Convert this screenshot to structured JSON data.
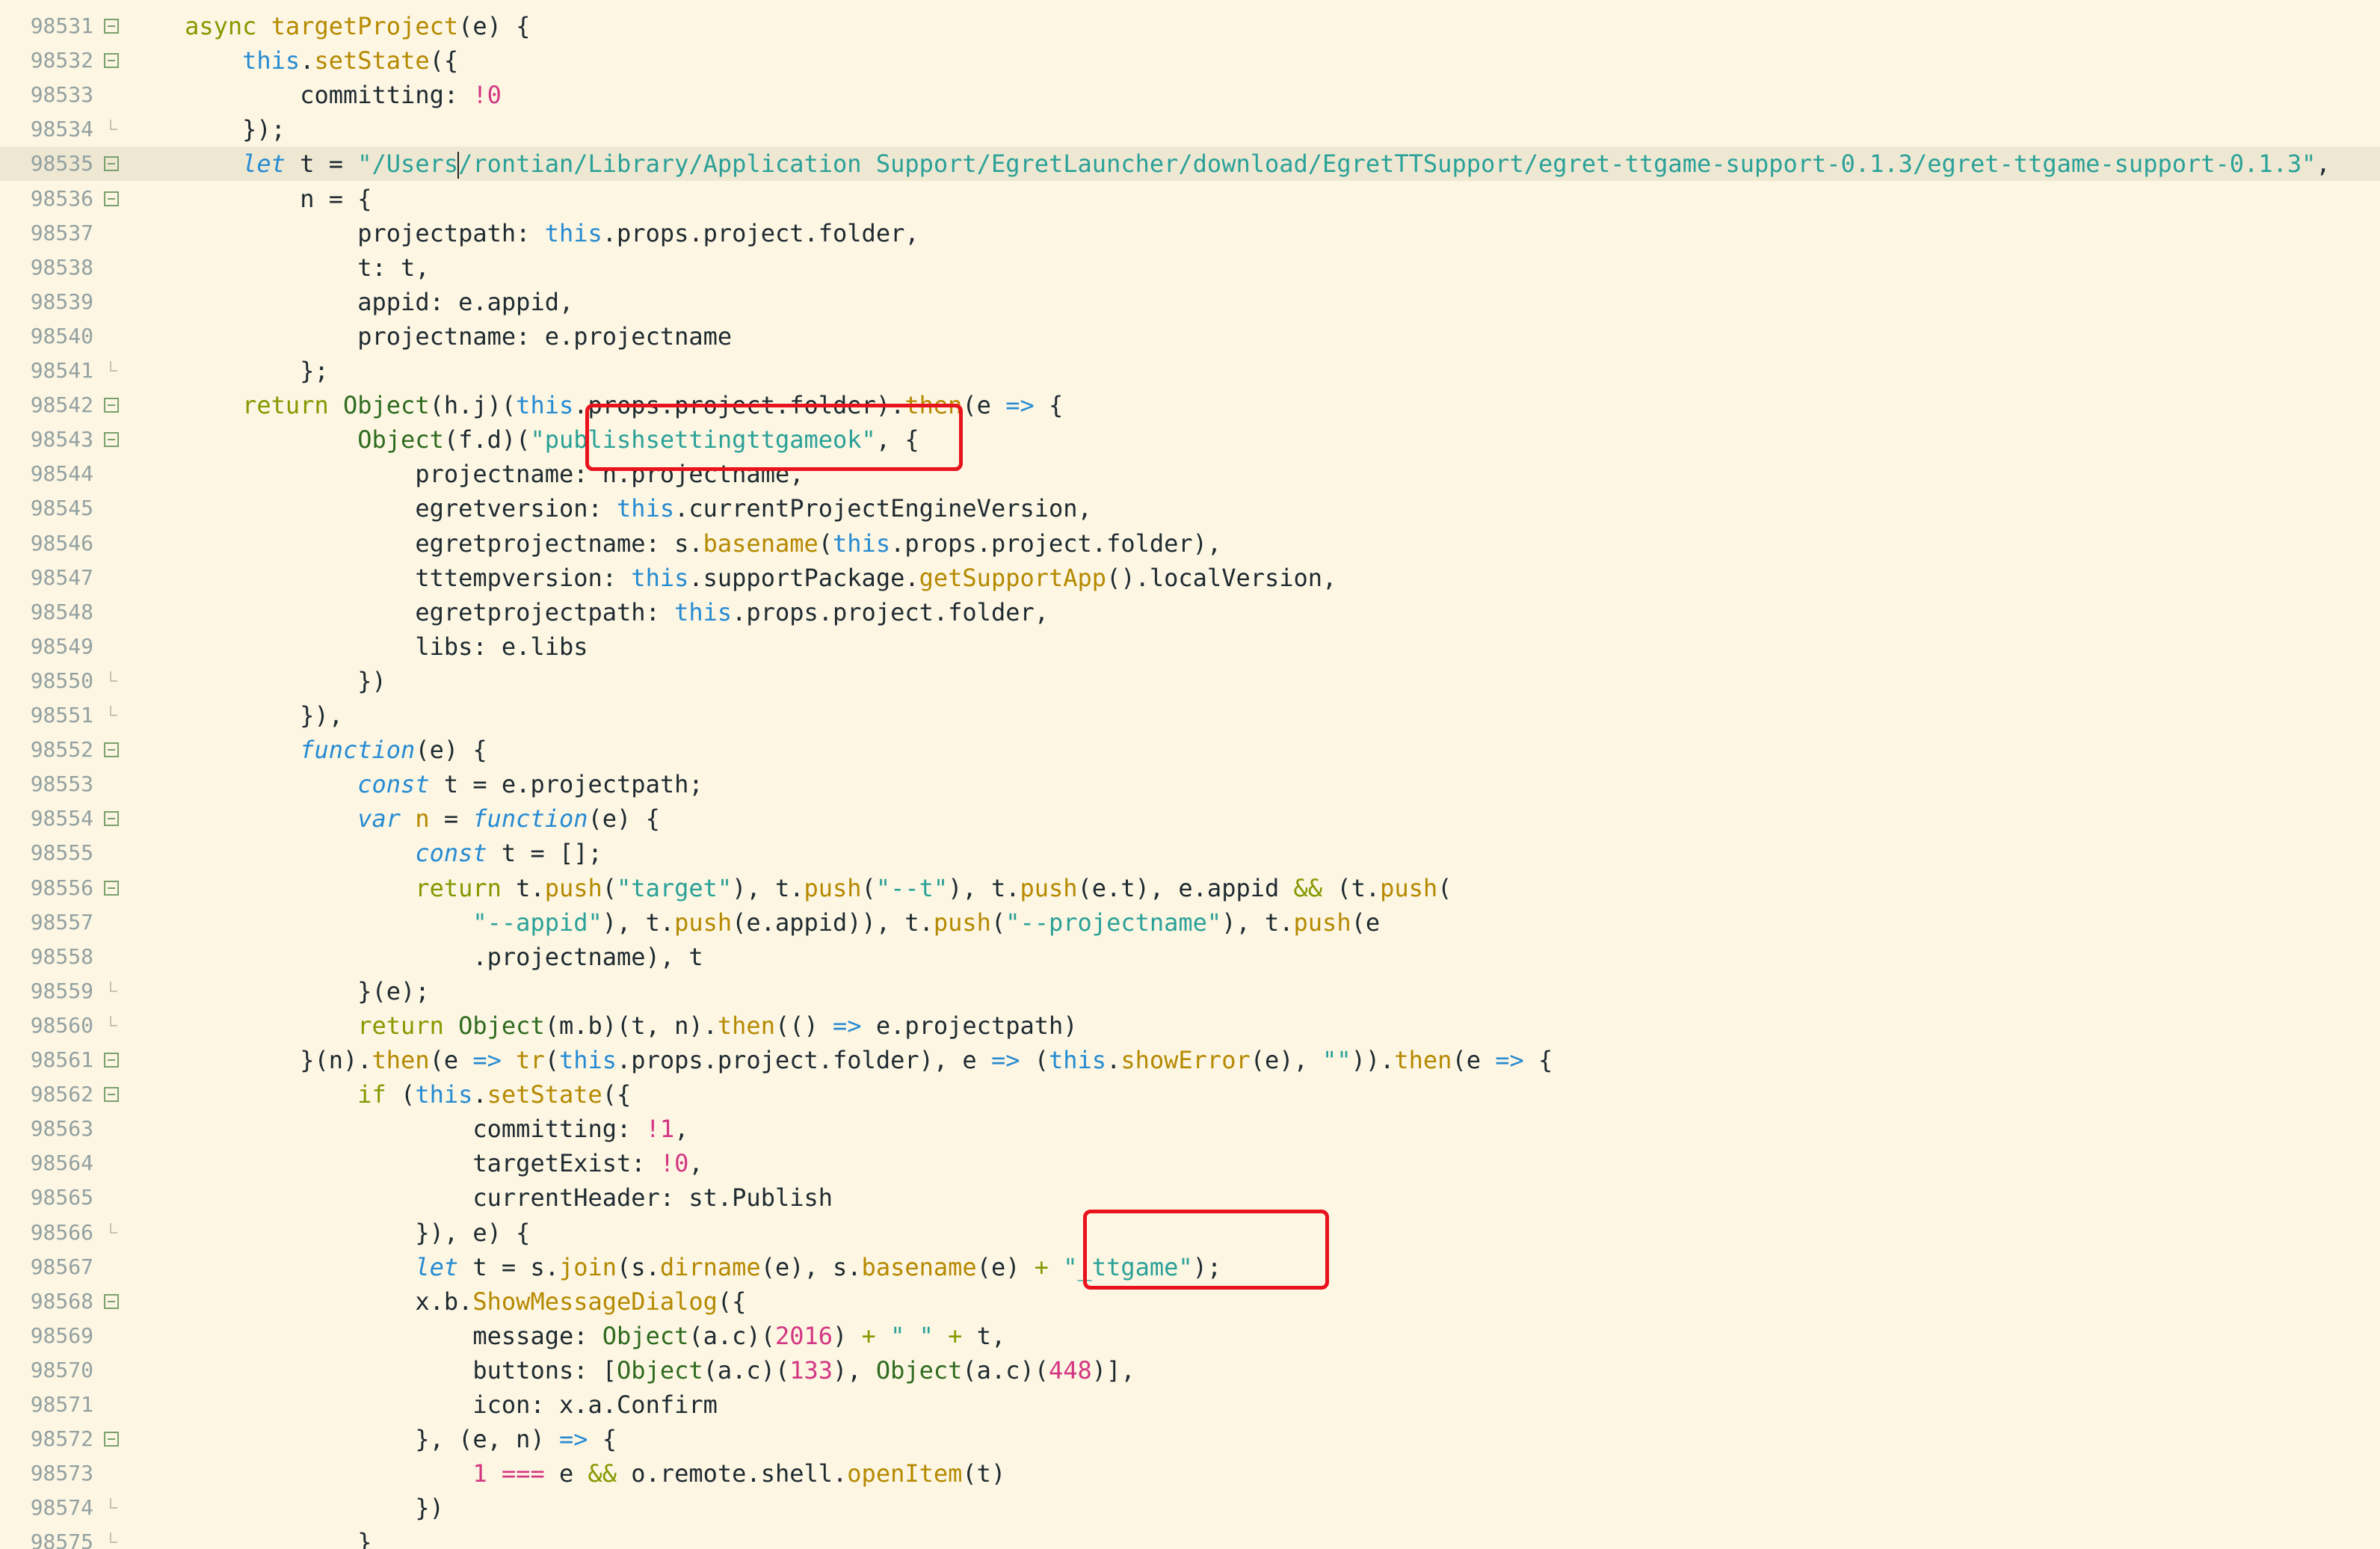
{
  "editor": {
    "current_line_index": 4,
    "cursor_line_index": 4,
    "lines": [
      {
        "no": "98531",
        "fold": "open",
        "indent": "    ",
        "tokens": [
          [
            "kw",
            "async "
          ],
          [
            "fn",
            "targetProject"
          ],
          [
            "id",
            "(e) {"
          ]
        ]
      },
      {
        "no": "98532",
        "fold": "open",
        "indent": "        ",
        "tokens": [
          [
            "this",
            "this"
          ],
          [
            "id",
            "."
          ],
          [
            "fn",
            "setState"
          ],
          [
            "id",
            "({"
          ]
        ]
      },
      {
        "no": "98533",
        "fold": "none",
        "indent": "            ",
        "tokens": [
          [
            "id",
            "committing: "
          ],
          [
            "ex",
            "!"
          ],
          [
            "num",
            "0"
          ]
        ]
      },
      {
        "no": "98534",
        "fold": "end",
        "indent": "        ",
        "tokens": [
          [
            "id",
            "});"
          ]
        ]
      },
      {
        "no": "98535",
        "fold": "open",
        "indent": "        ",
        "tokens": [
          [
            "ital",
            "let"
          ],
          [
            "id",
            " t = "
          ],
          [
            "str",
            "\"/Users"
          ],
          [
            "cursor",
            ""
          ],
          [
            "str",
            "/rontian/Library/Application Support/EgretLauncher/download/EgretTTSupport/egret-ttgame-support-0.1.3/egret-ttgame-support-0.1.3\""
          ],
          [
            "id",
            ","
          ]
        ]
      },
      {
        "no": "98536",
        "fold": "open",
        "indent": "            ",
        "tokens": [
          [
            "id",
            "n = {"
          ]
        ]
      },
      {
        "no": "98537",
        "fold": "none",
        "indent": "                ",
        "tokens": [
          [
            "id",
            "projectpath: "
          ],
          [
            "this",
            "this"
          ],
          [
            "id",
            ".props.project.folder,"
          ]
        ]
      },
      {
        "no": "98538",
        "fold": "none",
        "indent": "                ",
        "tokens": [
          [
            "id",
            "t: t,"
          ]
        ]
      },
      {
        "no": "98539",
        "fold": "none",
        "indent": "                ",
        "tokens": [
          [
            "id",
            "appid: e.appid,"
          ]
        ]
      },
      {
        "no": "98540",
        "fold": "none",
        "indent": "                ",
        "tokens": [
          [
            "id",
            "projectname: e.projectname"
          ]
        ]
      },
      {
        "no": "98541",
        "fold": "end",
        "indent": "            ",
        "tokens": [
          [
            "id",
            "};"
          ]
        ]
      },
      {
        "no": "98542",
        "fold": "open",
        "indent": "        ",
        "tokens": [
          [
            "kw",
            "return "
          ],
          [
            "cls",
            "Object"
          ],
          [
            "id",
            "(h.j)("
          ],
          [
            "this",
            "this"
          ],
          [
            "id",
            ".props.project.folder)."
          ],
          [
            "fn",
            "then"
          ],
          [
            "id",
            "(e "
          ],
          [
            "arrow",
            "=>"
          ],
          [
            "id",
            " {"
          ]
        ]
      },
      {
        "no": "98543",
        "fold": "open",
        "indent": "                ",
        "tokens": [
          [
            "cls",
            "Object"
          ],
          [
            "id",
            "(f.d)("
          ],
          [
            "str",
            "\"publishsettingttgameok\""
          ],
          [
            "id",
            ", {"
          ]
        ]
      },
      {
        "no": "98544",
        "fold": "none",
        "indent": "                    ",
        "tokens": [
          [
            "id",
            "projectname: n.projectname,"
          ]
        ]
      },
      {
        "no": "98545",
        "fold": "none",
        "indent": "                    ",
        "tokens": [
          [
            "id",
            "egretversion: "
          ],
          [
            "this",
            "this"
          ],
          [
            "id",
            ".currentProjectEngineVersion,"
          ]
        ]
      },
      {
        "no": "98546",
        "fold": "none",
        "indent": "                    ",
        "tokens": [
          [
            "id",
            "egretprojectname: s."
          ],
          [
            "fn",
            "basename"
          ],
          [
            "id",
            "("
          ],
          [
            "this",
            "this"
          ],
          [
            "id",
            ".props.project.folder),"
          ]
        ]
      },
      {
        "no": "98547",
        "fold": "none",
        "indent": "                    ",
        "tokens": [
          [
            "id",
            "tttempversion: "
          ],
          [
            "this",
            "this"
          ],
          [
            "id",
            ".supportPackage."
          ],
          [
            "fn",
            "getSupportApp"
          ],
          [
            "id",
            "().localVersion,"
          ]
        ]
      },
      {
        "no": "98548",
        "fold": "none",
        "indent": "                    ",
        "tokens": [
          [
            "id",
            "egretprojectpath: "
          ],
          [
            "this",
            "this"
          ],
          [
            "id",
            ".props.project.folder,"
          ]
        ]
      },
      {
        "no": "98549",
        "fold": "none",
        "indent": "                    ",
        "tokens": [
          [
            "id",
            "libs: e.libs"
          ]
        ]
      },
      {
        "no": "98550",
        "fold": "end",
        "indent": "                ",
        "tokens": [
          [
            "id",
            "})"
          ]
        ]
      },
      {
        "no": "98551",
        "fold": "end",
        "indent": "            ",
        "tokens": [
          [
            "id",
            "}),"
          ]
        ]
      },
      {
        "no": "98552",
        "fold": "open",
        "indent": "            ",
        "tokens": [
          [
            "ital",
            "function"
          ],
          [
            "id",
            "(e) {"
          ]
        ]
      },
      {
        "no": "98553",
        "fold": "none",
        "indent": "                ",
        "tokens": [
          [
            "ital",
            "const"
          ],
          [
            "id",
            " t = e.projectpath;"
          ]
        ]
      },
      {
        "no": "98554",
        "fold": "open",
        "indent": "                ",
        "tokens": [
          [
            "ital",
            "var"
          ],
          [
            "id",
            " "
          ],
          [
            "fn",
            "n"
          ],
          [
            "id",
            " = "
          ],
          [
            "ital",
            "function"
          ],
          [
            "id",
            "(e) {"
          ]
        ]
      },
      {
        "no": "98555",
        "fold": "none",
        "indent": "                    ",
        "tokens": [
          [
            "ital",
            "const"
          ],
          [
            "id",
            " t = [];"
          ]
        ]
      },
      {
        "no": "98556",
        "fold": "open",
        "indent": "                    ",
        "tokens": [
          [
            "kw",
            "return "
          ],
          [
            "id",
            "t."
          ],
          [
            "fn",
            "push"
          ],
          [
            "id",
            "("
          ],
          [
            "str",
            "\"target\""
          ],
          [
            "id",
            "), t."
          ],
          [
            "fn",
            "push"
          ],
          [
            "id",
            "("
          ],
          [
            "str",
            "\"--t\""
          ],
          [
            "id",
            "), t."
          ],
          [
            "fn",
            "push"
          ],
          [
            "id",
            "(e.t), e.appid "
          ],
          [
            "kw",
            "&&"
          ],
          [
            "id",
            " (t."
          ],
          [
            "fn",
            "push"
          ],
          [
            "id",
            "("
          ]
        ]
      },
      {
        "no": "98557",
        "fold": "none",
        "indent": "                        ",
        "tokens": [
          [
            "str",
            "\"--appid\""
          ],
          [
            "id",
            "), t."
          ],
          [
            "fn",
            "push"
          ],
          [
            "id",
            "(e.appid)), t."
          ],
          [
            "fn",
            "push"
          ],
          [
            "id",
            "("
          ],
          [
            "str",
            "\"--projectname\""
          ],
          [
            "id",
            "), t."
          ],
          [
            "fn",
            "push"
          ],
          [
            "id",
            "(e"
          ]
        ]
      },
      {
        "no": "98558",
        "fold": "none",
        "indent": "                        ",
        "tokens": [
          [
            "id",
            ".projectname), t"
          ]
        ]
      },
      {
        "no": "98559",
        "fold": "end",
        "indent": "                ",
        "tokens": [
          [
            "id",
            "}(e);"
          ]
        ]
      },
      {
        "no": "98560",
        "fold": "end",
        "indent": "                ",
        "tokens": [
          [
            "kw",
            "return "
          ],
          [
            "cls",
            "Object"
          ],
          [
            "id",
            "(m.b)(t, n)."
          ],
          [
            "fn",
            "then"
          ],
          [
            "id",
            "(() "
          ],
          [
            "arrow",
            "=>"
          ],
          [
            "id",
            " e.projectpath)"
          ]
        ]
      },
      {
        "no": "98561",
        "fold": "open",
        "indent": "            ",
        "tokens": [
          [
            "id",
            "}(n)."
          ],
          [
            "fn",
            "then"
          ],
          [
            "id",
            "(e "
          ],
          [
            "arrow",
            "=>"
          ],
          [
            "id",
            " "
          ],
          [
            "fn",
            "tr"
          ],
          [
            "id",
            "("
          ],
          [
            "this",
            "this"
          ],
          [
            "id",
            ".props.project.folder), e "
          ],
          [
            "arrow",
            "=>"
          ],
          [
            "id",
            " ("
          ],
          [
            "this",
            "this"
          ],
          [
            "id",
            "."
          ],
          [
            "fn",
            "showError"
          ],
          [
            "id",
            "(e), "
          ],
          [
            "str",
            "\"\""
          ],
          [
            "id",
            "))."
          ],
          [
            "fn",
            "then"
          ],
          [
            "id",
            "(e "
          ],
          [
            "arrow",
            "=>"
          ],
          [
            "id",
            " {"
          ]
        ]
      },
      {
        "no": "98562",
        "fold": "open",
        "indent": "                ",
        "tokens": [
          [
            "kw",
            "if"
          ],
          [
            "id",
            " ("
          ],
          [
            "this",
            "this"
          ],
          [
            "id",
            "."
          ],
          [
            "fn",
            "setState"
          ],
          [
            "id",
            "({"
          ]
        ]
      },
      {
        "no": "98563",
        "fold": "none",
        "indent": "                        ",
        "tokens": [
          [
            "id",
            "committing: "
          ],
          [
            "ex",
            "!"
          ],
          [
            "num",
            "1"
          ],
          [
            "id",
            ","
          ]
        ]
      },
      {
        "no": "98564",
        "fold": "none",
        "indent": "                        ",
        "tokens": [
          [
            "id",
            "targetExist: "
          ],
          [
            "ex",
            "!"
          ],
          [
            "num",
            "0"
          ],
          [
            "id",
            ","
          ]
        ]
      },
      {
        "no": "98565",
        "fold": "none",
        "indent": "                        ",
        "tokens": [
          [
            "id",
            "currentHeader: st.Publish"
          ]
        ]
      },
      {
        "no": "98566",
        "fold": "end",
        "indent": "                    ",
        "tokens": [
          [
            "id",
            "}), e) {"
          ]
        ]
      },
      {
        "no": "98567",
        "fold": "none",
        "indent": "                    ",
        "tokens": [
          [
            "ital",
            "let"
          ],
          [
            "id",
            " t = s."
          ],
          [
            "fn",
            "join"
          ],
          [
            "id",
            "(s."
          ],
          [
            "fn",
            "dirname"
          ],
          [
            "id",
            "(e), s."
          ],
          [
            "fn",
            "basename"
          ],
          [
            "id",
            "(e) "
          ],
          [
            "kw",
            "+"
          ],
          [
            "id",
            " "
          ],
          [
            "str",
            "\"_ttgame\""
          ],
          [
            "id",
            ");"
          ]
        ]
      },
      {
        "no": "98568",
        "fold": "open",
        "indent": "                    ",
        "tokens": [
          [
            "id",
            "x.b."
          ],
          [
            "fn",
            "ShowMessageDialog"
          ],
          [
            "id",
            "({"
          ]
        ]
      },
      {
        "no": "98569",
        "fold": "none",
        "indent": "                        ",
        "tokens": [
          [
            "id",
            "message: "
          ],
          [
            "cls",
            "Object"
          ],
          [
            "id",
            "(a.c)("
          ],
          [
            "num",
            "2016"
          ],
          [
            "id",
            ") "
          ],
          [
            "kw",
            "+"
          ],
          [
            "id",
            " "
          ],
          [
            "str",
            "\" \""
          ],
          [
            "id",
            " "
          ],
          [
            "kw",
            "+"
          ],
          [
            "id",
            " t,"
          ]
        ]
      },
      {
        "no": "98570",
        "fold": "none",
        "indent": "                        ",
        "tokens": [
          [
            "id",
            "buttons: ["
          ],
          [
            "cls",
            "Object"
          ],
          [
            "id",
            "(a.c)("
          ],
          [
            "num",
            "133"
          ],
          [
            "id",
            "), "
          ],
          [
            "cls",
            "Object"
          ],
          [
            "id",
            "(a.c)("
          ],
          [
            "num",
            "448"
          ],
          [
            "id",
            ")],"
          ]
        ]
      },
      {
        "no": "98571",
        "fold": "none",
        "indent": "                        ",
        "tokens": [
          [
            "id",
            "icon: x.a.Confirm"
          ]
        ]
      },
      {
        "no": "98572",
        "fold": "open",
        "indent": "                    ",
        "tokens": [
          [
            "id",
            "}, (e, n) "
          ],
          [
            "arrow",
            "=>"
          ],
          [
            "id",
            " {"
          ]
        ]
      },
      {
        "no": "98573",
        "fold": "none",
        "indent": "                        ",
        "tokens": [
          [
            "num",
            "1"
          ],
          [
            "id",
            " "
          ],
          [
            "op",
            "==="
          ],
          [
            "id",
            " e "
          ],
          [
            "kw",
            "&&"
          ],
          [
            "id",
            " o.remote.shell."
          ],
          [
            "fn",
            "openItem"
          ],
          [
            "id",
            "(t)"
          ]
        ]
      },
      {
        "no": "98574",
        "fold": "end",
        "indent": "                    ",
        "tokens": [
          [
            "id",
            "})"
          ]
        ]
      },
      {
        "no": "98575",
        "fold": "end",
        "indent": "                ",
        "tokens": [
          [
            "id",
            "}"
          ]
        ]
      }
    ]
  }
}
